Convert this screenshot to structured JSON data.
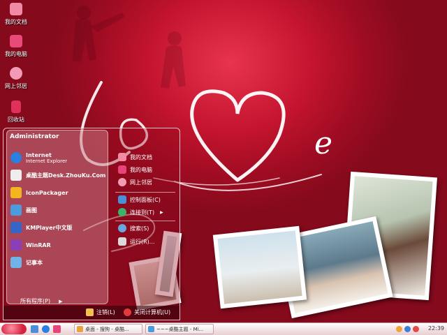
{
  "desktop": {
    "icons": [
      {
        "label": "我的文档",
        "icon": "my-documents-icon",
        "color": "#f08aa6"
      },
      {
        "label": "我的电脑",
        "icon": "my-computer-icon",
        "color": "#e84a7a"
      },
      {
        "label": "网上邻居",
        "icon": "network-places-icon",
        "color": "#f39bb6"
      },
      {
        "label": "回收站",
        "icon": "recycle-bin-icon",
        "color": "#e0305c"
      }
    ],
    "wallpaper_text": [
      "Lo",
      "e"
    ]
  },
  "start_menu": {
    "user": "Administrator",
    "programs": [
      {
        "title": "Internet",
        "subtitle": "Internet Explorer",
        "icon": "internet-explorer-icon",
        "color": "#2a7fe0"
      },
      {
        "title": "桌酷主题Desk.ZhouKu.Com",
        "subtitle": "",
        "icon": "desk-theme-icon",
        "color": "#eeeeee"
      },
      {
        "title": "IconPackager",
        "subtitle": "",
        "icon": "iconpackager-icon",
        "color": "#f2b51e"
      },
      {
        "title": "画图",
        "subtitle": "",
        "icon": "paint-icon",
        "color": "#4c9bdc"
      },
      {
        "title": "KMPlayer中文版",
        "subtitle": "",
        "icon": "kmplayer-icon",
        "color": "#3466c9"
      },
      {
        "title": "WinRAR",
        "subtitle": "",
        "icon": "winrar-icon",
        "color": "#8a3fb8"
      },
      {
        "title": "记事本",
        "subtitle": "",
        "icon": "notepad-icon",
        "color": "#6fb3e8"
      }
    ],
    "all_programs": "所有程序(P)",
    "places": [
      {
        "label": "我的文档",
        "icon": "my-documents-icon",
        "color": "#f28aa5"
      },
      {
        "label": "我的电脑",
        "icon": "my-computer-icon",
        "color": "#e8437a"
      },
      {
        "label": "网上邻居",
        "icon": "network-places-icon",
        "color": "#f39bb6"
      }
    ],
    "system": [
      {
        "label": "控制面板(C)",
        "icon": "control-panel-icon",
        "color": "#4a8fd8"
      },
      {
        "label": "连接到(T)",
        "icon": "connect-to-icon",
        "color": "#3bb36a"
      }
    ],
    "tools": [
      {
        "label": "搜索(S)",
        "icon": "search-icon",
        "color": "#6aa6e0"
      },
      {
        "label": "运行(R)...",
        "icon": "run-icon",
        "color": "#d9d9d9"
      }
    ],
    "logoff": "注销(L)",
    "shutdown": "关闭计算机(U)"
  },
  "taskbar": {
    "tasks": [
      {
        "label": "桌面 - 搜狗 - 桌酷...",
        "icon": "browser-icon"
      },
      {
        "label": "~~~桌酷主题 - Mi...",
        "icon": "paint-window-icon"
      }
    ],
    "clock": "22:39"
  }
}
